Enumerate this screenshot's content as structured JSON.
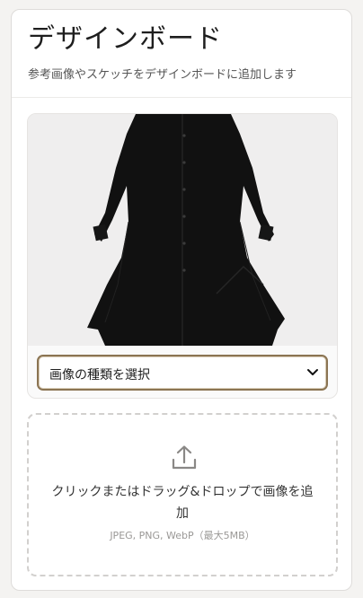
{
  "header": {
    "title": "デザインボード",
    "subtitle": "参考画像やスケッチをデザインボードに追加します"
  },
  "image_card": {
    "image_alt": "black dress",
    "select": {
      "selected": "画像の種類を選択"
    }
  },
  "dropzone": {
    "instruction": "クリックまたはドラッグ&ドロップで画像を追加",
    "formats": "JPEG, PNG, WebP（最大5MB）",
    "icon": "upload-icon"
  },
  "colors": {
    "accent": "#8b7452",
    "background": "#f4f3f1"
  }
}
